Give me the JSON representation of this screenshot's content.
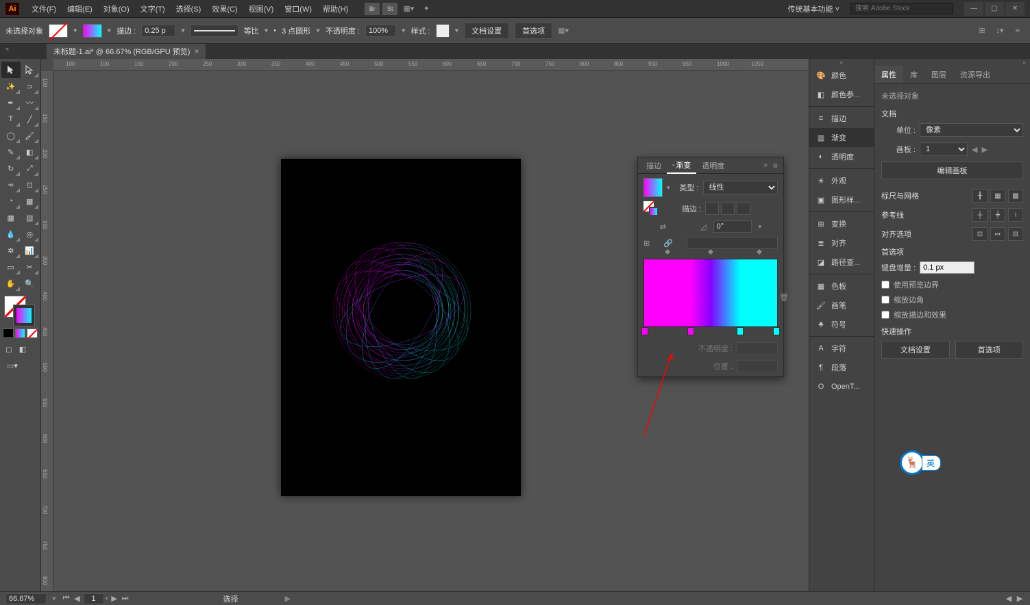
{
  "menubar": {
    "items": [
      "文件(F)",
      "编辑(E)",
      "对象(O)",
      "文字(T)",
      "选择(S)",
      "效果(C)",
      "视图(V)",
      "窗口(W)",
      "帮助(H)"
    ],
    "workspace": "传统基本功能",
    "search_placeholder": "搜索 Adobe Stock"
  },
  "optionsbar": {
    "no_selection": "未选择对象",
    "stroke_label": "描边 :",
    "stroke_width": "0.25 p",
    "stroke_uniform": "等比",
    "stroke_profile": "3 点圆形",
    "opacity_label": "不透明度 :",
    "opacity": "100%",
    "style_label": "样式 :",
    "doc_setup": "文档设置",
    "prefs": "首选项"
  },
  "doctab": {
    "title": "未标题-1.ai* @ 66.67% (RGB/GPU 预览)"
  },
  "ruler_h_labels": [
    "100",
    "100",
    "150",
    "200",
    "250",
    "300",
    "350",
    "400",
    "450",
    "500",
    "550",
    "600",
    "650",
    "700",
    "750",
    "800",
    "850",
    "900",
    "950",
    "1000",
    "1050"
  ],
  "ruler_v_labels": [
    "100",
    "150",
    "200",
    "250",
    "300",
    "350",
    "400",
    "450",
    "500",
    "550",
    "600",
    "650",
    "700",
    "750",
    "800"
  ],
  "gradient_panel": {
    "tabs": [
      "描边",
      "渐变",
      "透明度"
    ],
    "type_label": "类型 :",
    "type_value": "线性",
    "stroke_label": "描边 :",
    "angle": "0°",
    "opacity_label": "不透明度 :",
    "position_label": "位置 :"
  },
  "right_panels": {
    "items": [
      {
        "label": "颜色",
        "icon": "palette"
      },
      {
        "label": "颜色参...",
        "icon": "color-guide"
      },
      {
        "label": "描边",
        "icon": "stroke"
      },
      {
        "label": "渐变",
        "icon": "gradient",
        "active": true
      },
      {
        "label": "透明度",
        "icon": "transparency"
      },
      {
        "label": "外观",
        "icon": "appearance"
      },
      {
        "label": "图形样...",
        "icon": "graphic-styles"
      },
      {
        "label": "变换",
        "icon": "transform"
      },
      {
        "label": "对齐",
        "icon": "align"
      },
      {
        "label": "路径查...",
        "icon": "pathfinder"
      },
      {
        "label": "色板",
        "icon": "swatches"
      },
      {
        "label": "画笔",
        "icon": "brushes"
      },
      {
        "label": "符号",
        "icon": "symbols"
      },
      {
        "label": "字符",
        "icon": "character"
      },
      {
        "label": "段落",
        "icon": "paragraph"
      },
      {
        "label": "OpenT...",
        "icon": "opentype"
      }
    ]
  },
  "properties": {
    "tabs": [
      "属性",
      "库",
      "图层",
      "资源导出"
    ],
    "no_selection": "未选择对象",
    "doc_section": "文档",
    "unit_label": "单位 :",
    "unit_value": "像素",
    "artboard_label": "画板 :",
    "artboard_value": "1",
    "edit_artboards": "编辑画板",
    "ruler_grid_section": "标尺与网格",
    "guides_section": "参考线",
    "align_section": "对齐选项",
    "prefs_section": "首选项",
    "key_increment_label": "键盘增量 :",
    "key_increment_value": "0.1 px",
    "use_preview_bounds": "使用预览边界",
    "scale_corners": "缩放边角",
    "scale_strokes": "缩放描边和效果",
    "quick_actions": "快速操作",
    "doc_setup_btn": "文档设置",
    "prefs_btn": "首选项"
  },
  "statusbar": {
    "zoom": "66.67%",
    "artboard_num": "1",
    "tool": "选择"
  },
  "ime": {
    "lang": "英"
  }
}
